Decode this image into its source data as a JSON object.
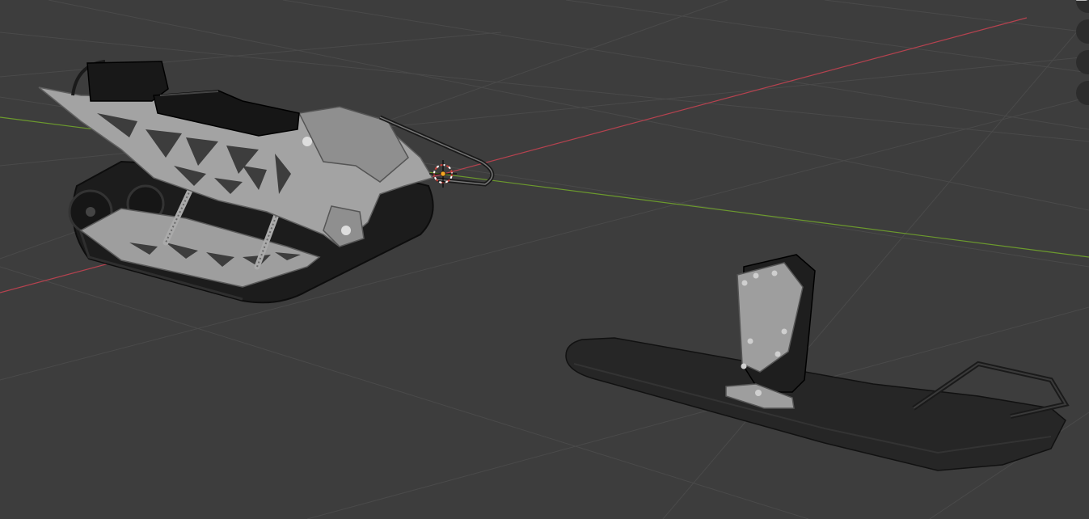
{
  "viewport": {
    "background": "#3d3d3d",
    "grid_color": "#4a4a4a",
    "x_axis_color": "#b5424f",
    "y_axis_color": "#6c9a2d",
    "cursor_color": "#c8413a",
    "origin_color": "#f5a623"
  },
  "objects": [
    {
      "name": "track-chassis",
      "material_body": "#a3a3a3",
      "material_track": "#1c1c1c"
    },
    {
      "name": "front-ski",
      "material_body": "#262626",
      "material_mount": "#9e9e9e"
    }
  ],
  "navigation": {
    "icons": [
      "zoom-icon",
      "hand-pan-icon",
      "camera-icon",
      "grid-perspective-icon"
    ]
  }
}
